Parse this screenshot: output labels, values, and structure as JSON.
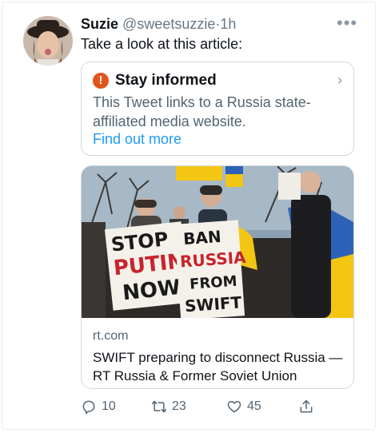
{
  "tweet": {
    "display_name": "Suzie",
    "handle": "@sweetsuzzie",
    "separator": "·",
    "time": "1h",
    "text": "Take a look at this article:",
    "more_icon": "ellipsis-icon"
  },
  "notice": {
    "icon": "warning-icon",
    "title": "Stay informed",
    "description": "This Tweet links to a Russia state-affiliated media website.",
    "link": "Find out more",
    "accent": "#e0551b"
  },
  "article": {
    "domain": "rt.com",
    "headline": "SWIFT preparing to disconnect Russia — RT Russia & Former Soviet Union",
    "sign_left": [
      "STOP",
      "PUTIN",
      "NOW"
    ],
    "sign_right": [
      "BAN",
      "RUSSIA",
      "FROM",
      "SWIFT"
    ]
  },
  "actions": {
    "replies": "10",
    "retweets": "23",
    "likes": "45"
  },
  "colors": {
    "link": "#1d9bf0",
    "muted": "#536471",
    "border": "#cfd9de"
  }
}
